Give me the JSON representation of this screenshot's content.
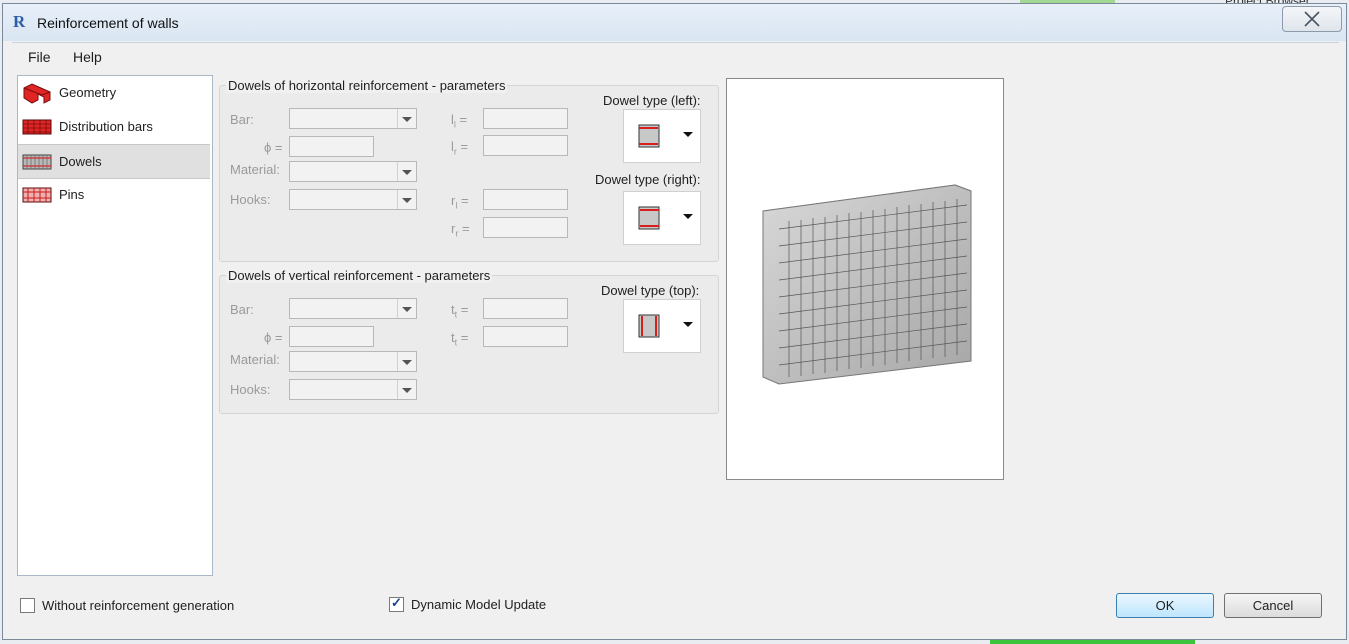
{
  "background": {
    "panel_label": "Project Browser"
  },
  "window": {
    "title": "Reinforcement of walls",
    "logo": "R",
    "close_icon": "close-icon"
  },
  "menu": [
    {
      "label": "File"
    },
    {
      "label": "Help"
    }
  ],
  "sidebar": {
    "items": [
      {
        "label": "Geometry",
        "icon": "geometry-icon",
        "active": false
      },
      {
        "label": "Distribution bars",
        "icon": "distribution-bars-icon",
        "active": false
      },
      {
        "label": "Dowels",
        "icon": "dowels-icon",
        "active": true
      },
      {
        "label": "Pins",
        "icon": "pins-icon",
        "active": false
      }
    ]
  },
  "horizontal": {
    "title": "Dowels of horizontal reinforcement  - parameters",
    "bar_label": "Bar:",
    "phi_label": "ϕ =",
    "material_label": "Material:",
    "hooks_label": "Hooks:",
    "l_l_label": "l",
    "l_l_sub": "l",
    "l_r_label": "l",
    "l_r_sub": "r",
    "r_l_label": "r",
    "r_l_sub": "l",
    "r_r_label": "r",
    "r_r_sub": "r",
    "eq": "=",
    "bar_value": "",
    "phi_value": "",
    "material_value": "",
    "hooks_value": "",
    "l_l_value": "",
    "l_r_value": "",
    "r_l_value": "",
    "r_r_value": "",
    "dowel_left_label": "Dowel type (left):",
    "dowel_right_label": "Dowel type (right):"
  },
  "vertical": {
    "title": "Dowels of vertical reinforcement - parameters",
    "bar_label": "Bar:",
    "phi_label": "ϕ =",
    "material_label": "Material:",
    "hooks_label": "Hooks:",
    "t1_label": "t",
    "t1_sub": "t",
    "t2_label": "t",
    "t2_sub": "t",
    "eq": "=",
    "bar_value": "",
    "phi_value": "",
    "material_value": "",
    "hooks_value": "",
    "t1_value": "",
    "t2_value": "",
    "dowel_top_label": "Dowel type (top):"
  },
  "colors": {
    "accent": "#2d5fa8",
    "rebar_red": "#d61f1f",
    "primary_button": "#bee6fd"
  },
  "footer": {
    "without_generation": {
      "label": "Without reinforcement generation",
      "checked": false
    },
    "dynamic_update": {
      "label": "Dynamic Model Update",
      "checked": true
    },
    "ok_label": "OK",
    "cancel_label": "Cancel"
  }
}
